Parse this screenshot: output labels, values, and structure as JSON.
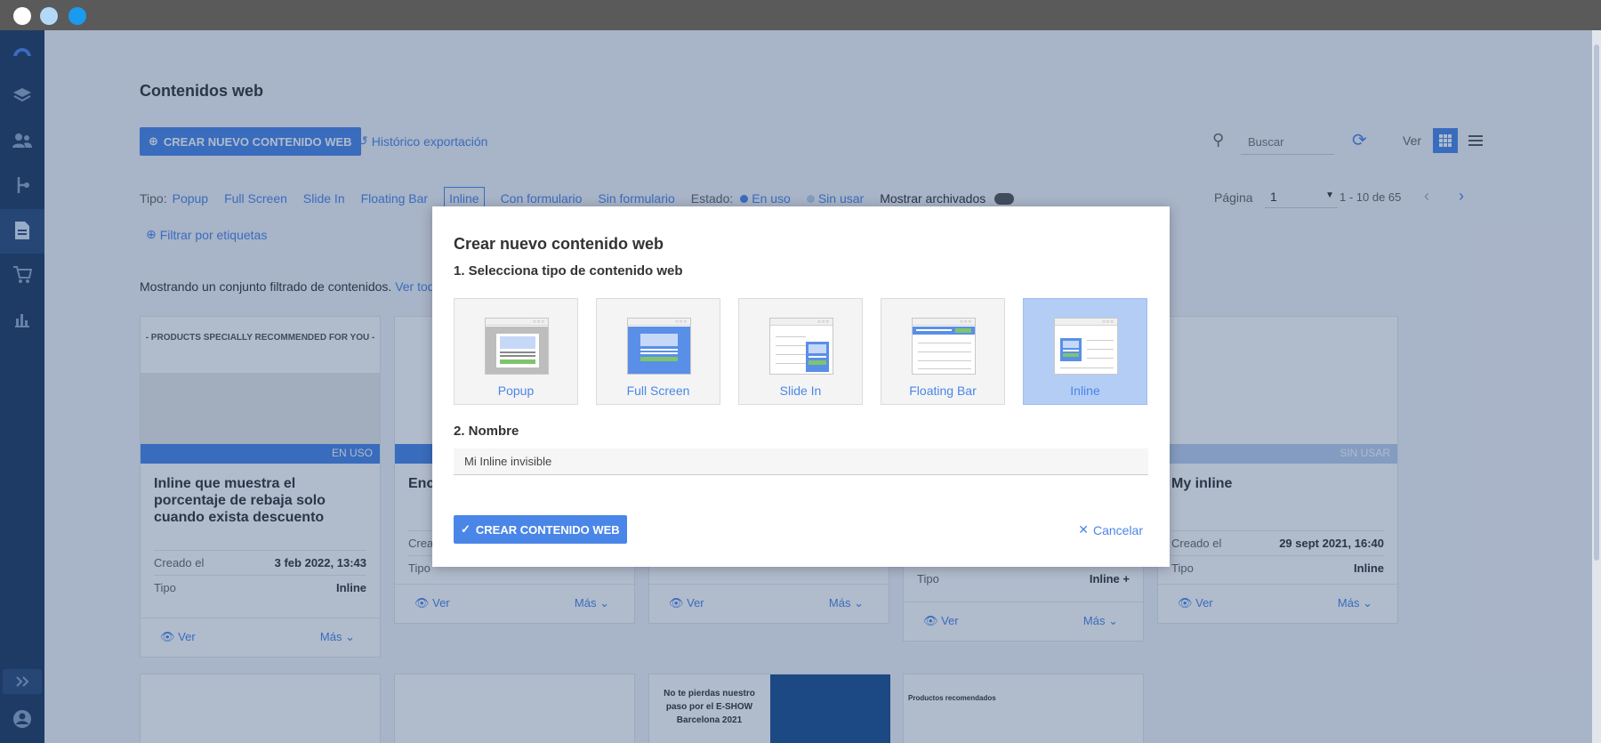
{
  "window": {
    "dots": [
      "#ffffff",
      "#b3d9f7",
      "#1a9bf0"
    ]
  },
  "page": {
    "title": "Contenidos web",
    "create_button": "Crear nuevo contenido web",
    "history_link": "Histórico exportación",
    "search_placeholder": "Buscar",
    "view_label": "Ver",
    "filters": {
      "type_label": "Tipo:",
      "types": [
        "Popup",
        "Full Screen",
        "Slide In",
        "Floating Bar",
        "Inline"
      ],
      "active_type": "Inline",
      "form_options": [
        "Con formulario",
        "Sin formulario"
      ],
      "state_label": "Estado:",
      "states": [
        "En uso",
        "Sin usar"
      ],
      "show_archived": "Mostrar archivados",
      "tags_link": "Filtrar por etiquetas"
    },
    "pagination": {
      "label": "Página",
      "value": "1",
      "range": "1 - 10 de 65"
    },
    "filtered_notice": "Mostrando un conjunto filtrado de contenidos.",
    "see_all": "Ver todo"
  },
  "cards": [
    {
      "banner": "- PRODUCTS SPECIALLY RECOMMENDED FOR YOU -",
      "status": "EN USO",
      "title": "Inline que muestra el porcentaje de rebaja solo cuando exista descuento",
      "created_label": "Creado el",
      "created_value": "3 feb 2022, 13:43",
      "type_label": "Tipo",
      "type_value": "Inline",
      "view": "Ver",
      "more": "Más"
    },
    {
      "title": "Enc",
      "created_label": "Crea",
      "type_label": "Tipo",
      "view": "Ver",
      "more": "Más"
    },
    {
      "view": "Ver",
      "more": "Más"
    },
    {
      "type_label": "Tipo",
      "type_value": "Inline +",
      "view": "Ver",
      "more": "Más"
    },
    {
      "status": "SIN USAR",
      "title": "My inline",
      "created_label": "Creado el",
      "created_value": "29 sept 2021, 16:40",
      "type_label": "Tipo",
      "type_value": "Inline",
      "view": "Ver",
      "more": "Más"
    }
  ],
  "bottom_cards": {
    "promo_line1": "No te pierdas nuestro",
    "promo_line2": "paso por el E-SHOW",
    "promo_line3": "Barcelona 2021",
    "recommended": "Productos recomendados"
  },
  "modal": {
    "title": "Crear nuevo contenido web",
    "step1": "1. Selecciona tipo de contenido web",
    "types": [
      {
        "label": "Popup",
        "icon": "popup-preview-icon"
      },
      {
        "label": "Full Screen",
        "icon": "fullscreen-preview-icon"
      },
      {
        "label": "Slide In",
        "icon": "slidein-preview-icon"
      },
      {
        "label": "Floating Bar",
        "icon": "floatingbar-preview-icon"
      },
      {
        "label": "Inline",
        "icon": "inline-preview-icon"
      }
    ],
    "selected_type": "Inline",
    "step2": "2. Nombre",
    "name_value": "Mi Inline invisible",
    "create_button": "Crear contenido web",
    "cancel": "Cancelar"
  },
  "colors": {
    "accent": "#4a86e8",
    "sidebar": "#1f3b63",
    "selected": "#b3cdf5"
  }
}
